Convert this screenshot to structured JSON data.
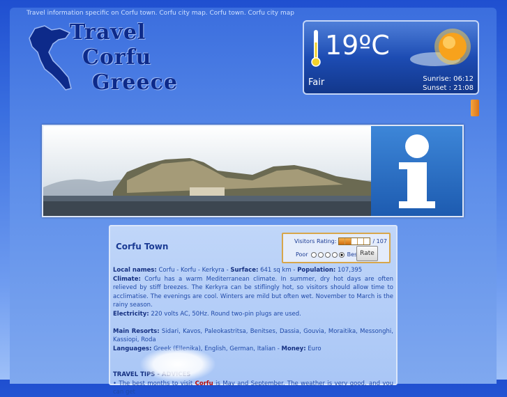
{
  "top_text": "Travel information specific on Corfu town. Corfu city map. Corfu town. Corfu city map",
  "logo": {
    "word1": "Travel",
    "word2": "Corfu",
    "word3": "Greece"
  },
  "weather": {
    "temperature": "19ºC",
    "condition": "Fair",
    "sunrise": "Sunrise: 06:12",
    "sunset": "Sunset : 21:08"
  },
  "content": {
    "title": "Corfu Town",
    "rating": {
      "label": "Visitors Rating:",
      "count": "/ 107",
      "filled_segments": 2,
      "poor_label": "Poor",
      "best_label": "Best",
      "rate_button": "Rate"
    },
    "local_names_label": "Local names:",
    "local_names_value": " Corfu - Korfu - Kerkyra - ",
    "surface_label": "Surface:",
    "surface_value": " 641 sq km - ",
    "population_label": "Population:",
    "population_value": " 107,395",
    "climate_label": "Climate:",
    "climate_value": " Corfu has a warm Mediterranean climate. In summer, dry hot days are often relieved by stiff breezes. The Kerkyra can be stiflingly hot, so visitors should allow time to acclimatise. The evenings are cool. Winters are mild but often wet. November to March is the rainy season.",
    "electricity_label": "Electricity:",
    "electricity_value": " 220 volts AC, 50Hz. Round two-pin plugs are used.",
    "resorts_label": "Main Resorts:",
    "resorts_value": " Sidari, Kavos, Paleokastritsa, Benitses, Dassia, Gouvia, Moraitika, Messonghi, Kassiopi, Roda",
    "languages_label": "Languages:",
    "languages_value": " Greek (Ellenika), English, German, Italian - ",
    "money_label": "Money:",
    "money_value": " Euro",
    "tips_heading": "TRAVEL TIPS - ADVICES",
    "tip1_prefix": "• The best months to visit ",
    "tip1_link": "Corfu",
    "tip1_suffix": " is May and September. The weather is very good, and you can get"
  }
}
